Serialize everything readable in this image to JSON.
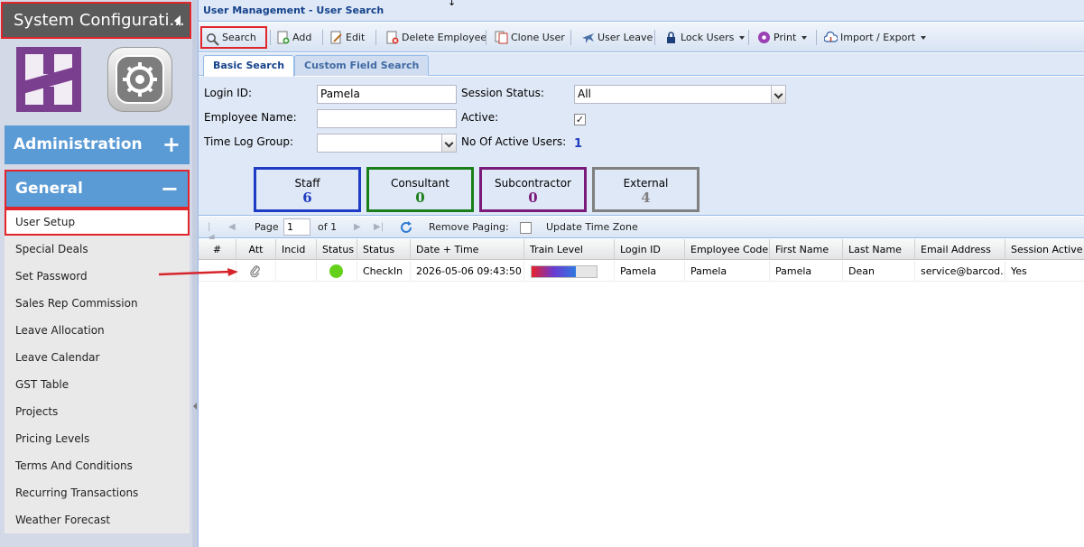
{
  "sidebar": {
    "header": "System Configurati...",
    "accordions": [
      {
        "label": "Administration",
        "sign": "+"
      },
      {
        "label": "General",
        "sign": "−"
      }
    ],
    "items": [
      {
        "label": "User Setup"
      },
      {
        "label": "Special Deals"
      },
      {
        "label": "Set Password"
      },
      {
        "label": "Sales Rep Commission"
      },
      {
        "label": "Leave Allocation"
      },
      {
        "label": "Leave Calendar"
      },
      {
        "label": "GST Table"
      },
      {
        "label": "Projects"
      },
      {
        "label": "Pricing Levels"
      },
      {
        "label": "Terms And Conditions"
      },
      {
        "label": "Recurring Transactions"
      },
      {
        "label": "Weather Forecast"
      }
    ]
  },
  "panel": {
    "title": "User Management - User Search",
    "resize_glyph": "↓"
  },
  "toolbar": {
    "search": "Search",
    "add": "Add",
    "edit": "Edit",
    "delete": "Delete Employee",
    "clone": "Clone User",
    "leave": "User Leave",
    "lock": "Lock Users",
    "print": "Print",
    "import_export": "Import / Export"
  },
  "tabs": [
    "Basic Search",
    "Custom Field Search"
  ],
  "form": {
    "login_id_label": "Login ID:",
    "login_id_value": "Pamela",
    "employee_name_label": "Employee Name:",
    "employee_name_value": "",
    "time_log_group_label": "Time Log Group:",
    "time_log_group_value": "",
    "session_status_label": "Session Status:",
    "session_status_value": "All",
    "active_label": "Active:",
    "active_checked": "✓",
    "active_users_label": "No Of Active Users:",
    "active_users_value": "1"
  },
  "tiles": [
    {
      "label": "Staff",
      "count": "6",
      "color": "#1f3cc4"
    },
    {
      "label": "Consultant",
      "count": "0",
      "color": "#1a7f1a"
    },
    {
      "label": "Subcontractor",
      "count": "0",
      "color": "#7a1a7a"
    },
    {
      "label": "External",
      "count": "4",
      "color": "#808080"
    }
  ],
  "pager": {
    "page_label": "Page",
    "page_value": "1",
    "of_label": "of 1",
    "remove_paging": "Remove Paging:",
    "update_tz": "Update Time Zone"
  },
  "grid": {
    "columns": [
      "#",
      "Att",
      "Incid",
      "Status",
      "Status",
      "Date + Time",
      "Train Level",
      "Login ID",
      "Employee Code",
      "First Name",
      "Last Name",
      "Email Address",
      "Session Active"
    ],
    "rows": [
      {
        "status_text": "CheckIn",
        "datetime": "2026-05-06 09:43:50",
        "train_level_pct": 68,
        "login_id": "Pamela",
        "employee_code": "Pamela",
        "first_name": "Pamela",
        "last_name": "Dean",
        "email": "service@barcod...",
        "session_active": "Yes",
        "status_color": "#66d11a"
      }
    ]
  }
}
